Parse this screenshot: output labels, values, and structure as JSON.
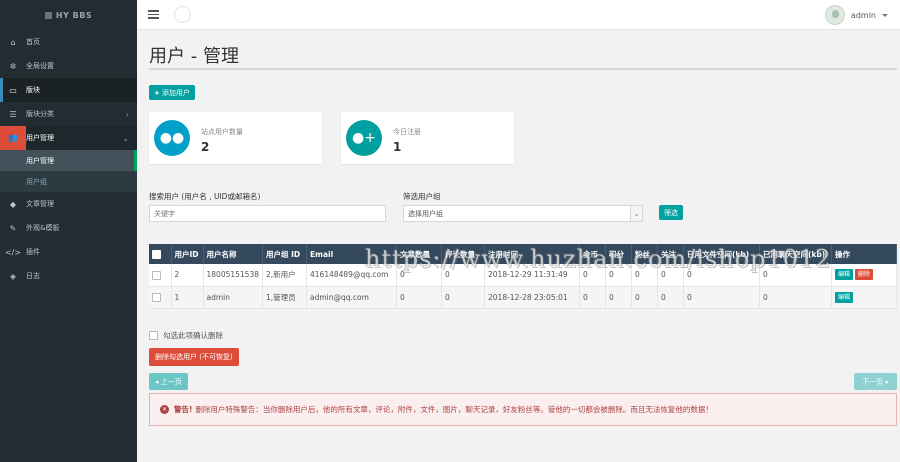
{
  "app": {
    "brand": "HY BBS"
  },
  "header": {
    "username": "admin"
  },
  "sidebar": {
    "items": [
      {
        "label": "首页",
        "icon": "home-icon"
      },
      {
        "label": "全局设置",
        "icon": "gear-icon"
      },
      {
        "label": "版块",
        "icon": "monitor-icon"
      },
      {
        "label": "版块分类",
        "icon": "list-icon"
      },
      {
        "label": "用户管理",
        "icon": "users-icon"
      },
      {
        "label": "文章管理",
        "icon": "tag-icon"
      },
      {
        "label": "外观&模板",
        "icon": "brush-icon"
      },
      {
        "label": "插件",
        "icon": "code-icon"
      },
      {
        "label": "日志",
        "icon": "cube-icon"
      }
    ],
    "sub_items": [
      {
        "label": "用户管理"
      },
      {
        "label": "用户组"
      }
    ]
  },
  "page": {
    "title": "用户 - 管理",
    "add_button": "添加用户",
    "stats": [
      {
        "label": "站点用户数量",
        "value": "2"
      },
      {
        "label": "今日注册",
        "value": "1"
      }
    ],
    "search": {
      "label": "搜索用户 (用户名 , UID或邮箱名)",
      "placeholder": "关键字"
    },
    "filter": {
      "label": "筛选用户组",
      "selected": "选择用户组",
      "button": "筛选"
    }
  },
  "table": {
    "headers": [
      "用户ID",
      "用户名称",
      "用户组 ID",
      "Email",
      "文章数量",
      "评论数量",
      "注册时间",
      "金币",
      "积分",
      "粉丝",
      "关注",
      "已用文件空间(kb)",
      "已用聊天空间(kb)",
      "操作"
    ],
    "rows": [
      [
        "2",
        "18005151538",
        "2,新用户",
        "416148489@qq.com",
        "0",
        "0",
        "2018-12-29 11:31:49",
        "0",
        "0",
        "0",
        "0",
        "0",
        "0"
      ],
      [
        "1",
        "admin",
        "1,管理员",
        "admin@qq.com",
        "0",
        "0",
        "2018-12-28 23:05:01",
        "0",
        "0",
        "0",
        "0",
        "0",
        "0"
      ]
    ],
    "edit_label": "编辑",
    "delete_label": "删除"
  },
  "actions": {
    "confirm_checkbox": "勾选此项确认删除",
    "delete_selected": "删除勾选用户 (不可恢复)",
    "prev": "上一页",
    "next": "下一页"
  },
  "alert": {
    "strong": "警告!",
    "message": "删除用户特殊警告：当你删除用户后，他的所有文章，评论，附件，文件，图片，聊天记录，好友粉丝等。管他的一切都会被删除。而且无法恢复他的数据！"
  },
  "watermark": "https://www.huzhan.com/ishop1012",
  "colors": {
    "sidebar": "#222d32",
    "teal": "#00a0a0",
    "danger": "#dd4b39",
    "table_header": "#34495e"
  }
}
